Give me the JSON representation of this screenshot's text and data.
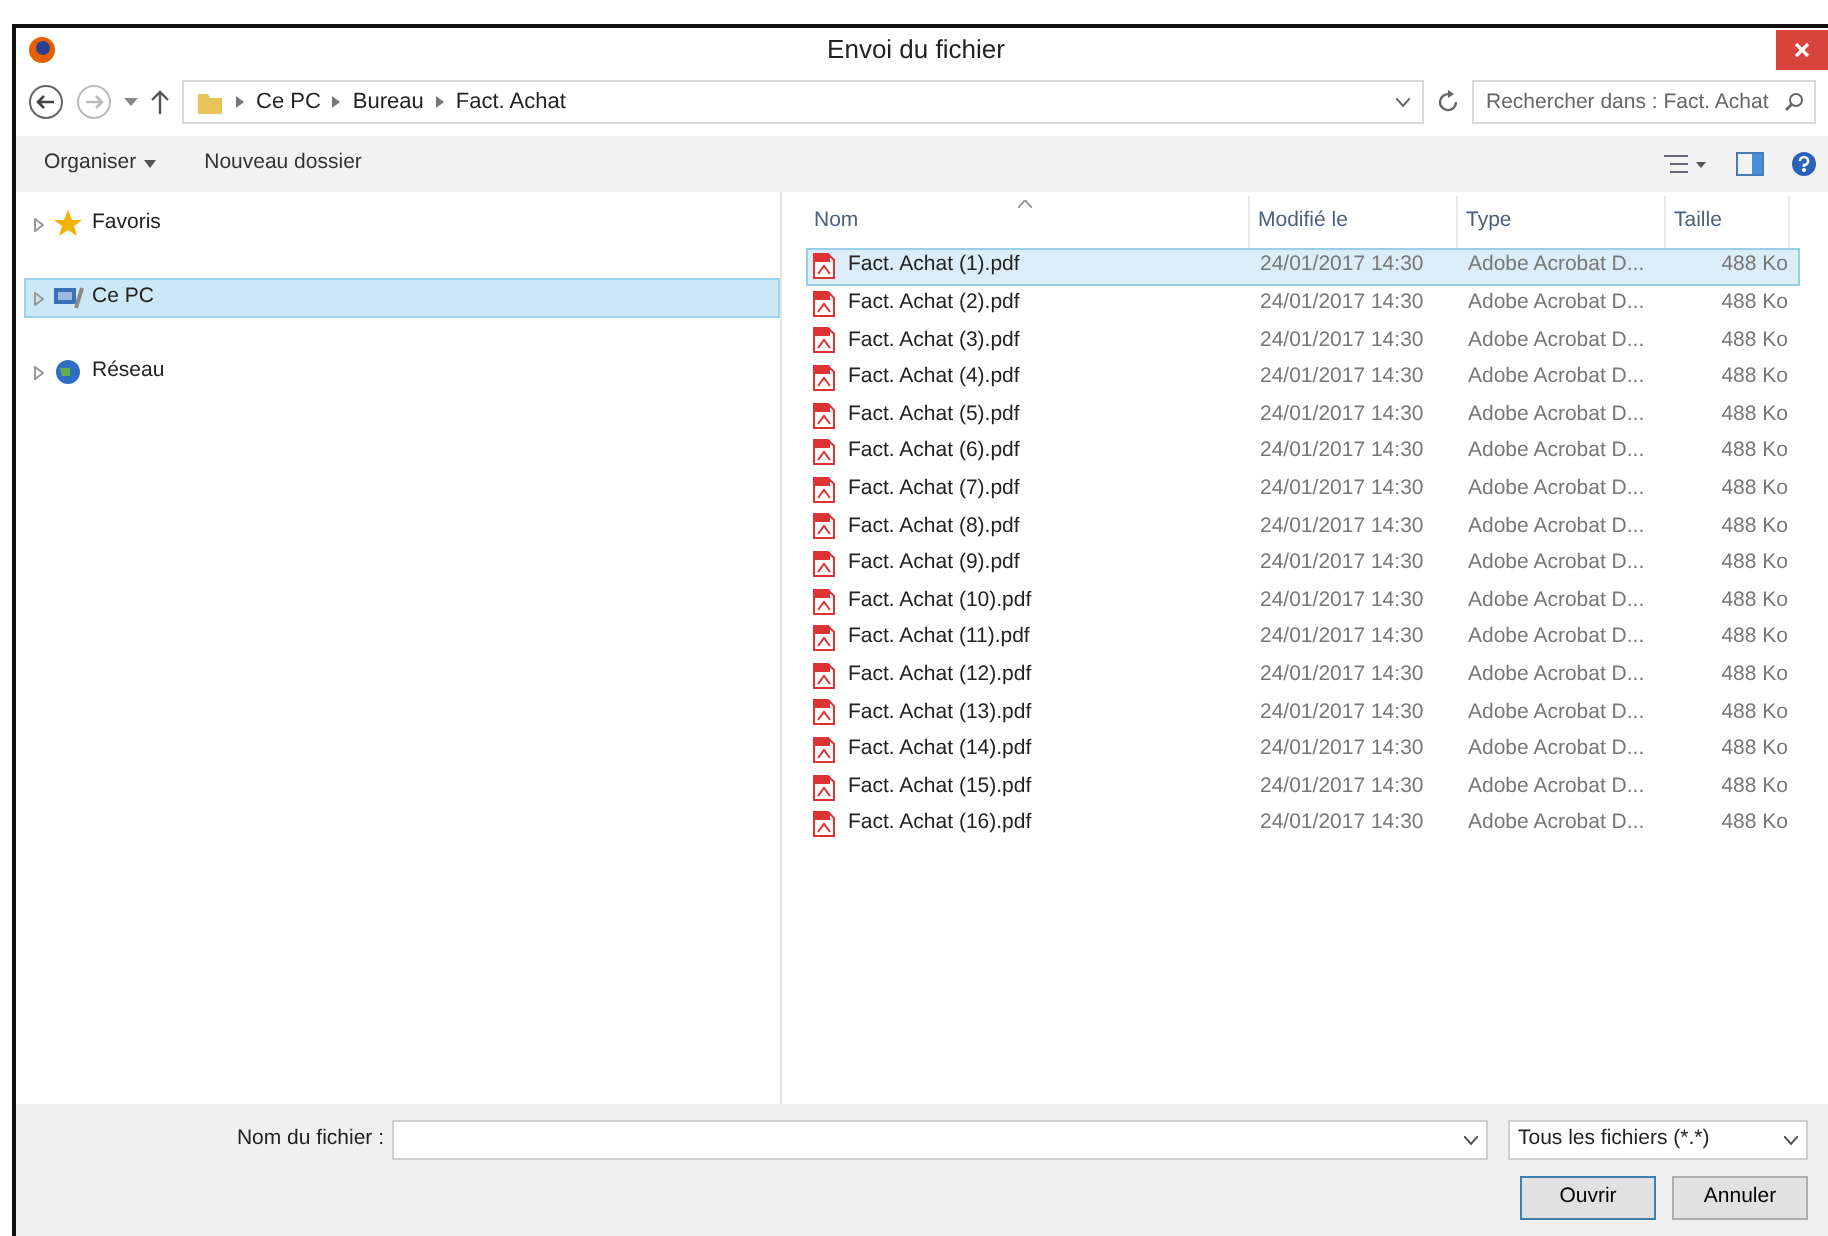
{
  "window": {
    "title": "Envoi du fichier"
  },
  "address": {
    "breadcrumbs": [
      "Ce PC",
      "Bureau",
      "Fact. Achat"
    ],
    "search_placeholder": "Rechercher dans : Fact. Achat"
  },
  "toolbar": {
    "organize": "Organiser",
    "new_folder": "Nouveau dossier"
  },
  "sidebar": {
    "items": [
      {
        "label": "Favoris",
        "kind": "star",
        "selected": false
      },
      {
        "label": "Ce PC",
        "kind": "pc",
        "selected": true
      },
      {
        "label": "Réseau",
        "kind": "network",
        "selected": false
      }
    ]
  },
  "table": {
    "columns": [
      "Nom",
      "Modifié le",
      "Type",
      "Taille"
    ],
    "rows": [
      {
        "name": "Fact. Achat (1).pdf",
        "modified": "24/01/2017 14:30",
        "type": "Adobe Acrobat D...",
        "size": "488 Ko",
        "selected": true
      },
      {
        "name": "Fact. Achat (2).pdf",
        "modified": "24/01/2017 14:30",
        "type": "Adobe Acrobat D...",
        "size": "488 Ko",
        "selected": false
      },
      {
        "name": "Fact. Achat (3).pdf",
        "modified": "24/01/2017 14:30",
        "type": "Adobe Acrobat D...",
        "size": "488 Ko",
        "selected": false
      },
      {
        "name": "Fact. Achat (4).pdf",
        "modified": "24/01/2017 14:30",
        "type": "Adobe Acrobat D...",
        "size": "488 Ko",
        "selected": false
      },
      {
        "name": "Fact. Achat (5).pdf",
        "modified": "24/01/2017 14:30",
        "type": "Adobe Acrobat D...",
        "size": "488 Ko",
        "selected": false
      },
      {
        "name": "Fact. Achat (6).pdf",
        "modified": "24/01/2017 14:30",
        "type": "Adobe Acrobat D...",
        "size": "488 Ko",
        "selected": false
      },
      {
        "name": "Fact. Achat (7).pdf",
        "modified": "24/01/2017 14:30",
        "type": "Adobe Acrobat D...",
        "size": "488 Ko",
        "selected": false
      },
      {
        "name": "Fact. Achat (8).pdf",
        "modified": "24/01/2017 14:30",
        "type": "Adobe Acrobat D...",
        "size": "488 Ko",
        "selected": false
      },
      {
        "name": "Fact. Achat (9).pdf",
        "modified": "24/01/2017 14:30",
        "type": "Adobe Acrobat D...",
        "size": "488 Ko",
        "selected": false
      },
      {
        "name": "Fact. Achat (10).pdf",
        "modified": "24/01/2017 14:30",
        "type": "Adobe Acrobat D...",
        "size": "488 Ko",
        "selected": false
      },
      {
        "name": "Fact. Achat (11).pdf",
        "modified": "24/01/2017 14:30",
        "type": "Adobe Acrobat D...",
        "size": "488 Ko",
        "selected": false
      },
      {
        "name": "Fact. Achat (12).pdf",
        "modified": "24/01/2017 14:30",
        "type": "Adobe Acrobat D...",
        "size": "488 Ko",
        "selected": false
      },
      {
        "name": "Fact. Achat (13).pdf",
        "modified": "24/01/2017 14:30",
        "type": "Adobe Acrobat D...",
        "size": "488 Ko",
        "selected": false
      },
      {
        "name": "Fact. Achat (14).pdf",
        "modified": "24/01/2017 14:30",
        "type": "Adobe Acrobat D...",
        "size": "488 Ko",
        "selected": false
      },
      {
        "name": "Fact. Achat (15).pdf",
        "modified": "24/01/2017 14:30",
        "type": "Adobe Acrobat D...",
        "size": "488 Ko",
        "selected": false
      },
      {
        "name": "Fact. Achat (16).pdf",
        "modified": "24/01/2017 14:30",
        "type": "Adobe Acrobat D...",
        "size": "488 Ko",
        "selected": false
      }
    ]
  },
  "footer": {
    "filename_label": "Nom du fichier :",
    "file_type": "Tous les fichiers (*.*)",
    "buttons": [
      "Ouvrir",
      "Annuler"
    ]
  }
}
